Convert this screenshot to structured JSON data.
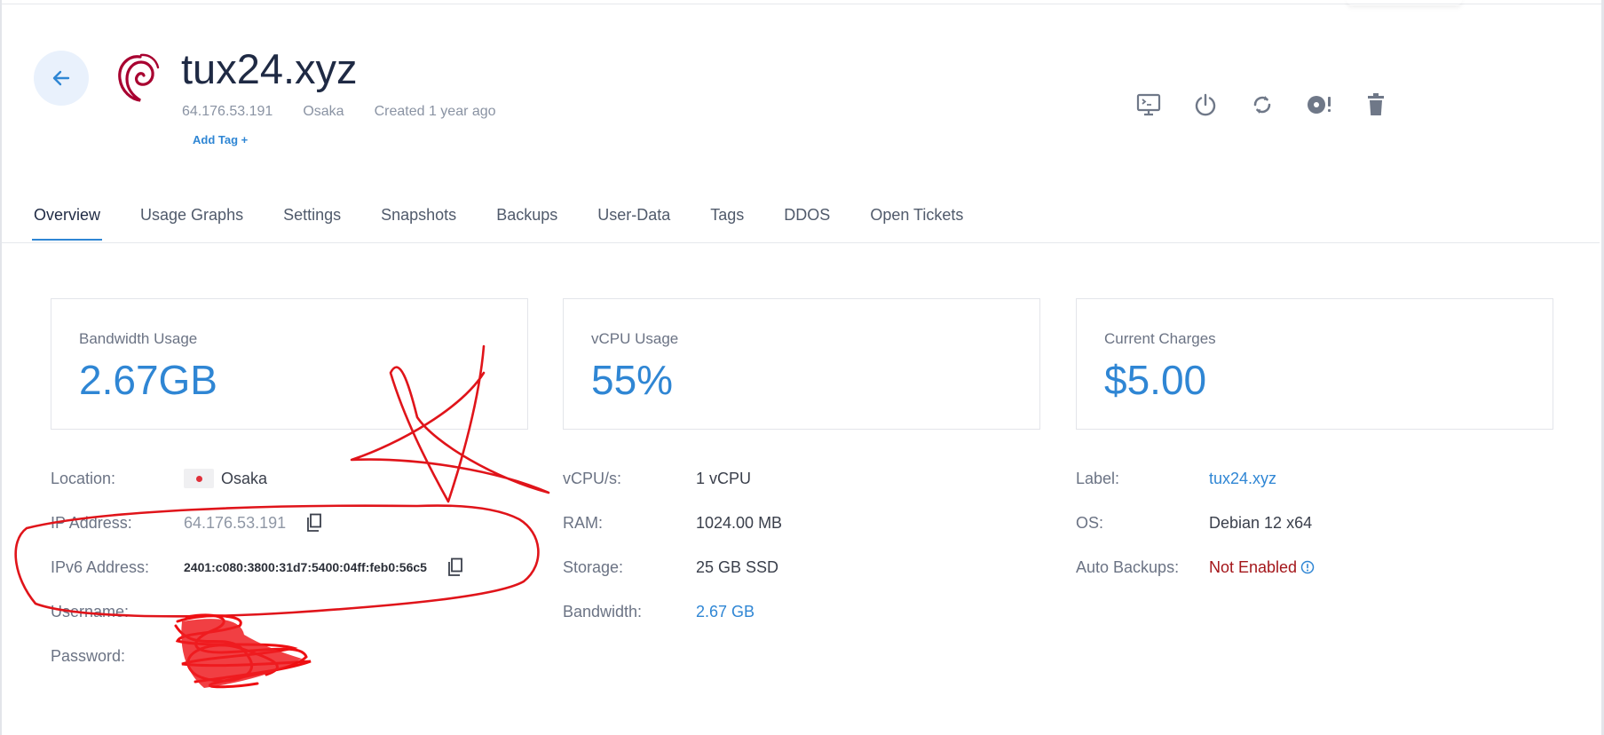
{
  "header": {
    "title": "tux24.xyz",
    "ip": "64.176.53.191",
    "location": "Osaka",
    "created": "Created 1 year ago",
    "add_tag": "Add Tag +",
    "os_logo_icon": "debian-swirl-icon",
    "accent_color": "#2f86d4"
  },
  "actions": [
    {
      "name": "console-icon"
    },
    {
      "name": "power-icon"
    },
    {
      "name": "restart-icon"
    },
    {
      "name": "reinstall-disc-icon"
    },
    {
      "name": "trash-icon"
    }
  ],
  "tabs": [
    {
      "label": "Overview",
      "active": true
    },
    {
      "label": "Usage Graphs"
    },
    {
      "label": "Settings"
    },
    {
      "label": "Snapshots"
    },
    {
      "label": "Backups"
    },
    {
      "label": "User-Data"
    },
    {
      "label": "Tags"
    },
    {
      "label": "DDOS"
    },
    {
      "label": "Open Tickets"
    }
  ],
  "cards": [
    {
      "label": "Bandwidth Usage",
      "value": "2.67GB"
    },
    {
      "label": "vCPU Usage",
      "value": "55%"
    },
    {
      "label": "Current Charges",
      "value": "$5.00"
    }
  ],
  "details": {
    "location_label": "Location:",
    "location_value": "Osaka",
    "ip_label": "IP Address:",
    "ip_value": "64.176.53.191",
    "ipv6_label": "IPv6 Address:",
    "ipv6_value": "2401:c080:3800:31d7:5400:04ff:feb0:56c5",
    "username_label": "Username:",
    "password_label": "Password:",
    "vcpu_label": "vCPU/s:",
    "vcpu_value": "1 vCPU",
    "ram_label": "RAM:",
    "ram_value": "1024.00 MB",
    "storage_label": "Storage:",
    "storage_value": "25 GB SSD",
    "bandwidth_label": "Bandwidth:",
    "bandwidth_value": "2.67 GB",
    "label_label": "Label:",
    "label_value": "tux24.xyz",
    "os_label": "OS:",
    "os_value": "Debian 12 x64",
    "backups_label": "Auto Backups:",
    "backups_value": "Not Enabled"
  }
}
